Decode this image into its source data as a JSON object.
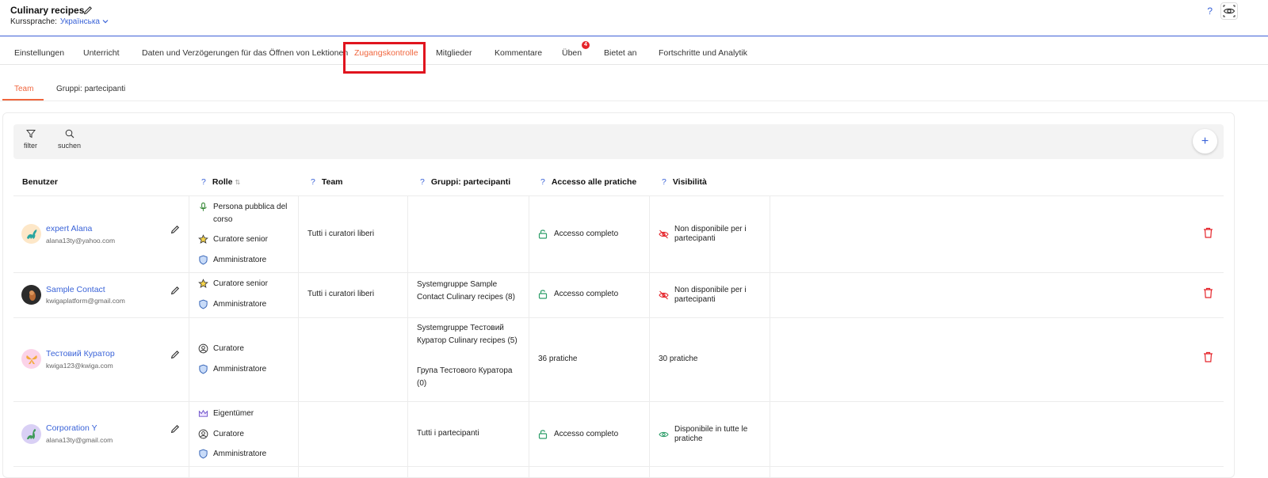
{
  "header": {
    "course_title": "Culinary recipes",
    "lang_label": "Kurssprache:",
    "lang_value": "Українська",
    "help": "?"
  },
  "tabs": [
    {
      "label": "Einstellungen"
    },
    {
      "label": "Unterricht"
    },
    {
      "label": "Daten und Verzögerungen für das Öffnen von Lektionen"
    },
    {
      "label": "Zugangskontrolle",
      "active": true
    },
    {
      "label": "Mitglieder"
    },
    {
      "label": "Kommentare"
    },
    {
      "label": "Üben",
      "badge": "4"
    },
    {
      "label": "Bietet an"
    },
    {
      "label": "Fortschritte und Analytik"
    }
  ],
  "subtabs": [
    {
      "label": "Team",
      "active": true
    },
    {
      "label": "Gruppi: partecipanti"
    }
  ],
  "toolbar": {
    "filter": "filter",
    "search": "suchen",
    "add": "+"
  },
  "columns": {
    "user": "Benutzer",
    "role": "Rolle",
    "team": "Team",
    "groups": "Gruppi: partecipanti",
    "access": "Accesso alle pratiche",
    "visibility": "Visibilità",
    "help": "?"
  },
  "rows": [
    {
      "name": "expert Alana",
      "email": "alana13ty@yahoo.com",
      "roles": [
        {
          "icon": "microphone-icon",
          "label": "Persona pubblica del corso"
        },
        {
          "icon": "star-icon",
          "label": "Curatore senior"
        },
        {
          "icon": "shield-icon",
          "label": "Amministratore"
        }
      ],
      "team": "Tutti i curatori liberi",
      "groups": [],
      "access": "Accesso completo",
      "access_icon": "lock-open-icon",
      "visibility": "Non disponibile per i partecipanti",
      "visibility_icon": "eye-off-icon"
    },
    {
      "name": "Sample Contact",
      "email": "kwigaplatform@gmail.com",
      "roles": [
        {
          "icon": "star-icon",
          "label": "Curatore senior"
        },
        {
          "icon": "shield-icon",
          "label": "Amministratore"
        }
      ],
      "team": "Tutti i curatori liberi",
      "groups": [
        "Systemgruppe Sample Contact Culinary recipes (8)"
      ],
      "access": "Accesso completo",
      "access_icon": "lock-open-icon",
      "visibility": "Non disponibile per i partecipanti",
      "visibility_icon": "eye-off-icon"
    },
    {
      "name": "Тестовий Куратор",
      "email": "kwiga123@kwiga.com",
      "roles": [
        {
          "icon": "user-circle-icon",
          "label": "Curatore"
        },
        {
          "icon": "shield-icon",
          "label": "Amministratore"
        }
      ],
      "team": "",
      "groups": [
        "Systemgruppe Тестовий Куратор Culinary recipes (5)",
        "Група Тестового Куратора (0)"
      ],
      "access": "36 pratiche",
      "visibility": "30 pratiche"
    },
    {
      "name": "Corporation Y",
      "email": "alana13ty@gmail.com",
      "roles": [
        {
          "icon": "crown-icon",
          "label": "Eigentümer"
        },
        {
          "icon": "user-circle-icon",
          "label": "Curatore"
        },
        {
          "icon": "shield-icon",
          "label": "Amministratore"
        }
      ],
      "team": "",
      "groups": [
        "Tutti i partecipanti"
      ],
      "access": "Accesso completo",
      "access_icon": "lock-open-icon",
      "visibility": "Disponibile in tutte le pratiche",
      "visibility_icon": "eye-icon"
    }
  ],
  "colors": {
    "accent": "#f0653d",
    "link": "#3a63d8",
    "danger": "#e5242a",
    "success": "#2e9e6a"
  }
}
